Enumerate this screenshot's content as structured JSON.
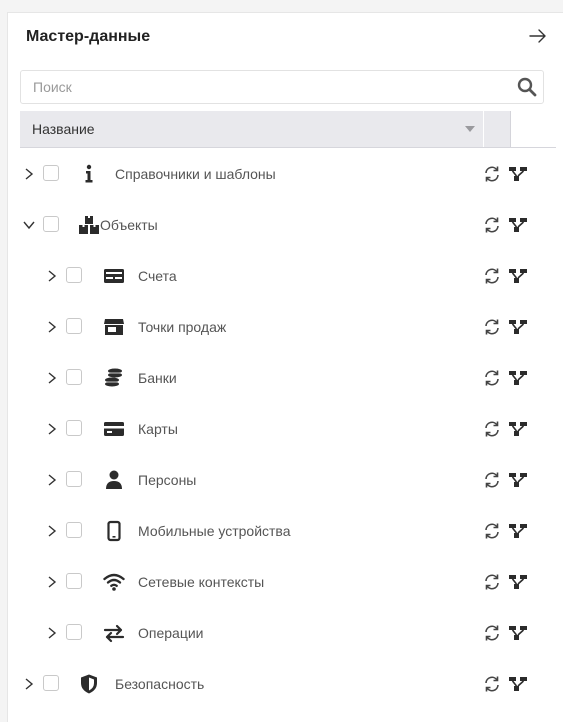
{
  "panel": {
    "title": "Мастер-данные",
    "collapse_icon": "arrow-right-icon"
  },
  "search": {
    "placeholder": "Поиск",
    "value": "",
    "icon": "search-icon"
  },
  "table": {
    "column_header": "Название",
    "sort_icon": "caret-down-icon"
  },
  "tree": {
    "items": [
      {
        "label": "Справочники и шаблоны",
        "icon": "info-icon",
        "expanded": false,
        "checked": false
      },
      {
        "label": "Объекты",
        "icon": "boxes-icon",
        "expanded": true,
        "checked": false
      },
      {
        "label": "Счета",
        "icon": "account-card-icon",
        "expanded": false,
        "checked": false
      },
      {
        "label": "Точки продаж",
        "icon": "store-icon",
        "expanded": false,
        "checked": false
      },
      {
        "label": "Банки",
        "icon": "coins-icon",
        "expanded": false,
        "checked": false
      },
      {
        "label": "Карты",
        "icon": "credit-card-icon",
        "expanded": false,
        "checked": false
      },
      {
        "label": "Персоны",
        "icon": "person-icon",
        "expanded": false,
        "checked": false
      },
      {
        "label": "Мобильные устройства",
        "icon": "mobile-icon",
        "expanded": false,
        "checked": false
      },
      {
        "label": "Сетевые контексты",
        "icon": "wifi-icon",
        "expanded": false,
        "checked": false
      },
      {
        "label": "Операции",
        "icon": "exchange-icon",
        "expanded": false,
        "checked": false
      },
      {
        "label": "Безопасность",
        "icon": "shield-icon",
        "expanded": false,
        "checked": false
      }
    ],
    "row_actions": [
      "refresh-icon",
      "hierarchy-icon"
    ]
  },
  "colors": {
    "header_bg": "#e9e9ed",
    "icon_dark": "#2b2b2b",
    "text": "#555555"
  }
}
